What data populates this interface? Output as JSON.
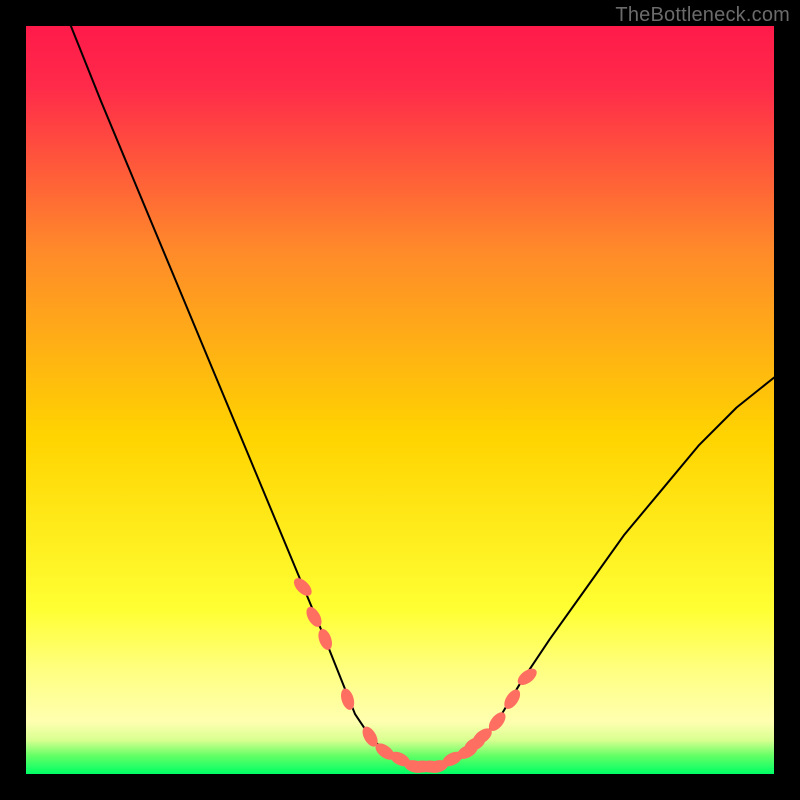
{
  "watermark": "TheBottleneck.com",
  "colors": {
    "background": "#000000",
    "gradient_top": "#ff1a4a",
    "gradient_mid": "#ffd400",
    "gradient_band": "#ffff7a",
    "gradient_bottom": "#00ff66",
    "curve": "#000000",
    "marker": "#ff6f61"
  },
  "chart_data": {
    "type": "line",
    "title": "",
    "xlabel": "",
    "ylabel": "",
    "xlim": [
      0,
      100
    ],
    "ylim": [
      0,
      100
    ],
    "grid": false,
    "legend": false,
    "series": [
      {
        "name": "bottleneck-curve",
        "x": [
          6,
          10,
          15,
          20,
          25,
          30,
          35,
          40,
          44,
          46,
          48,
          50,
          52,
          54,
          56,
          58,
          60,
          63,
          66,
          70,
          75,
          80,
          85,
          90,
          95,
          100
        ],
        "y": [
          100,
          90,
          78,
          66,
          54,
          42,
          30,
          18,
          8,
          5,
          3,
          2,
          1,
          1,
          1,
          2,
          4,
          7,
          12,
          18,
          25,
          32,
          38,
          44,
          49,
          53
        ]
      }
    ],
    "markers": [
      {
        "name": "highlight-range",
        "x": [
          37,
          38.5,
          40,
          43,
          46,
          48,
          50,
          52,
          53,
          54,
          55,
          57,
          59,
          60,
          61,
          63,
          65,
          67
        ],
        "y": [
          25,
          21,
          18,
          10,
          5,
          3,
          2,
          1,
          1,
          1,
          1,
          2,
          3,
          4,
          5,
          7,
          10,
          13
        ]
      }
    ],
    "annotations": []
  }
}
